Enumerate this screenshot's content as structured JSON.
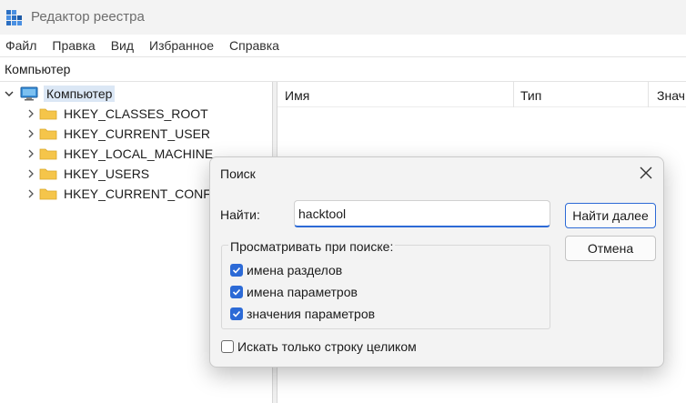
{
  "window": {
    "title": "Редактор реестра"
  },
  "menu": [
    "Файл",
    "Правка",
    "Вид",
    "Избранное",
    "Справка"
  ],
  "address": "Компьютер",
  "tree": {
    "root": "Компьютер",
    "children": [
      "HKEY_CLASSES_ROOT",
      "HKEY_CURRENT_USER",
      "HKEY_LOCAL_MACHINE",
      "HKEY_USERS",
      "HKEY_CURRENT_CONFIG"
    ]
  },
  "columns": [
    "Имя",
    "Тип",
    "Знач"
  ],
  "dialog": {
    "title": "Поиск",
    "find_label": "Найти:",
    "find_value": "hacktool",
    "find_next": "Найти далее",
    "cancel": "Отмена",
    "group_label": "Просматривать при поиске:",
    "options": [
      {
        "label": "имена разделов",
        "checked": true
      },
      {
        "label": "имена параметров",
        "checked": true
      },
      {
        "label": "значения параметров",
        "checked": true
      }
    ],
    "whole_string": {
      "label": "Искать только строку целиком",
      "checked": false
    }
  },
  "colors": {
    "accent": "#2c6ad6",
    "folder": "#f5c54a",
    "selection": "#dbe7f5"
  }
}
